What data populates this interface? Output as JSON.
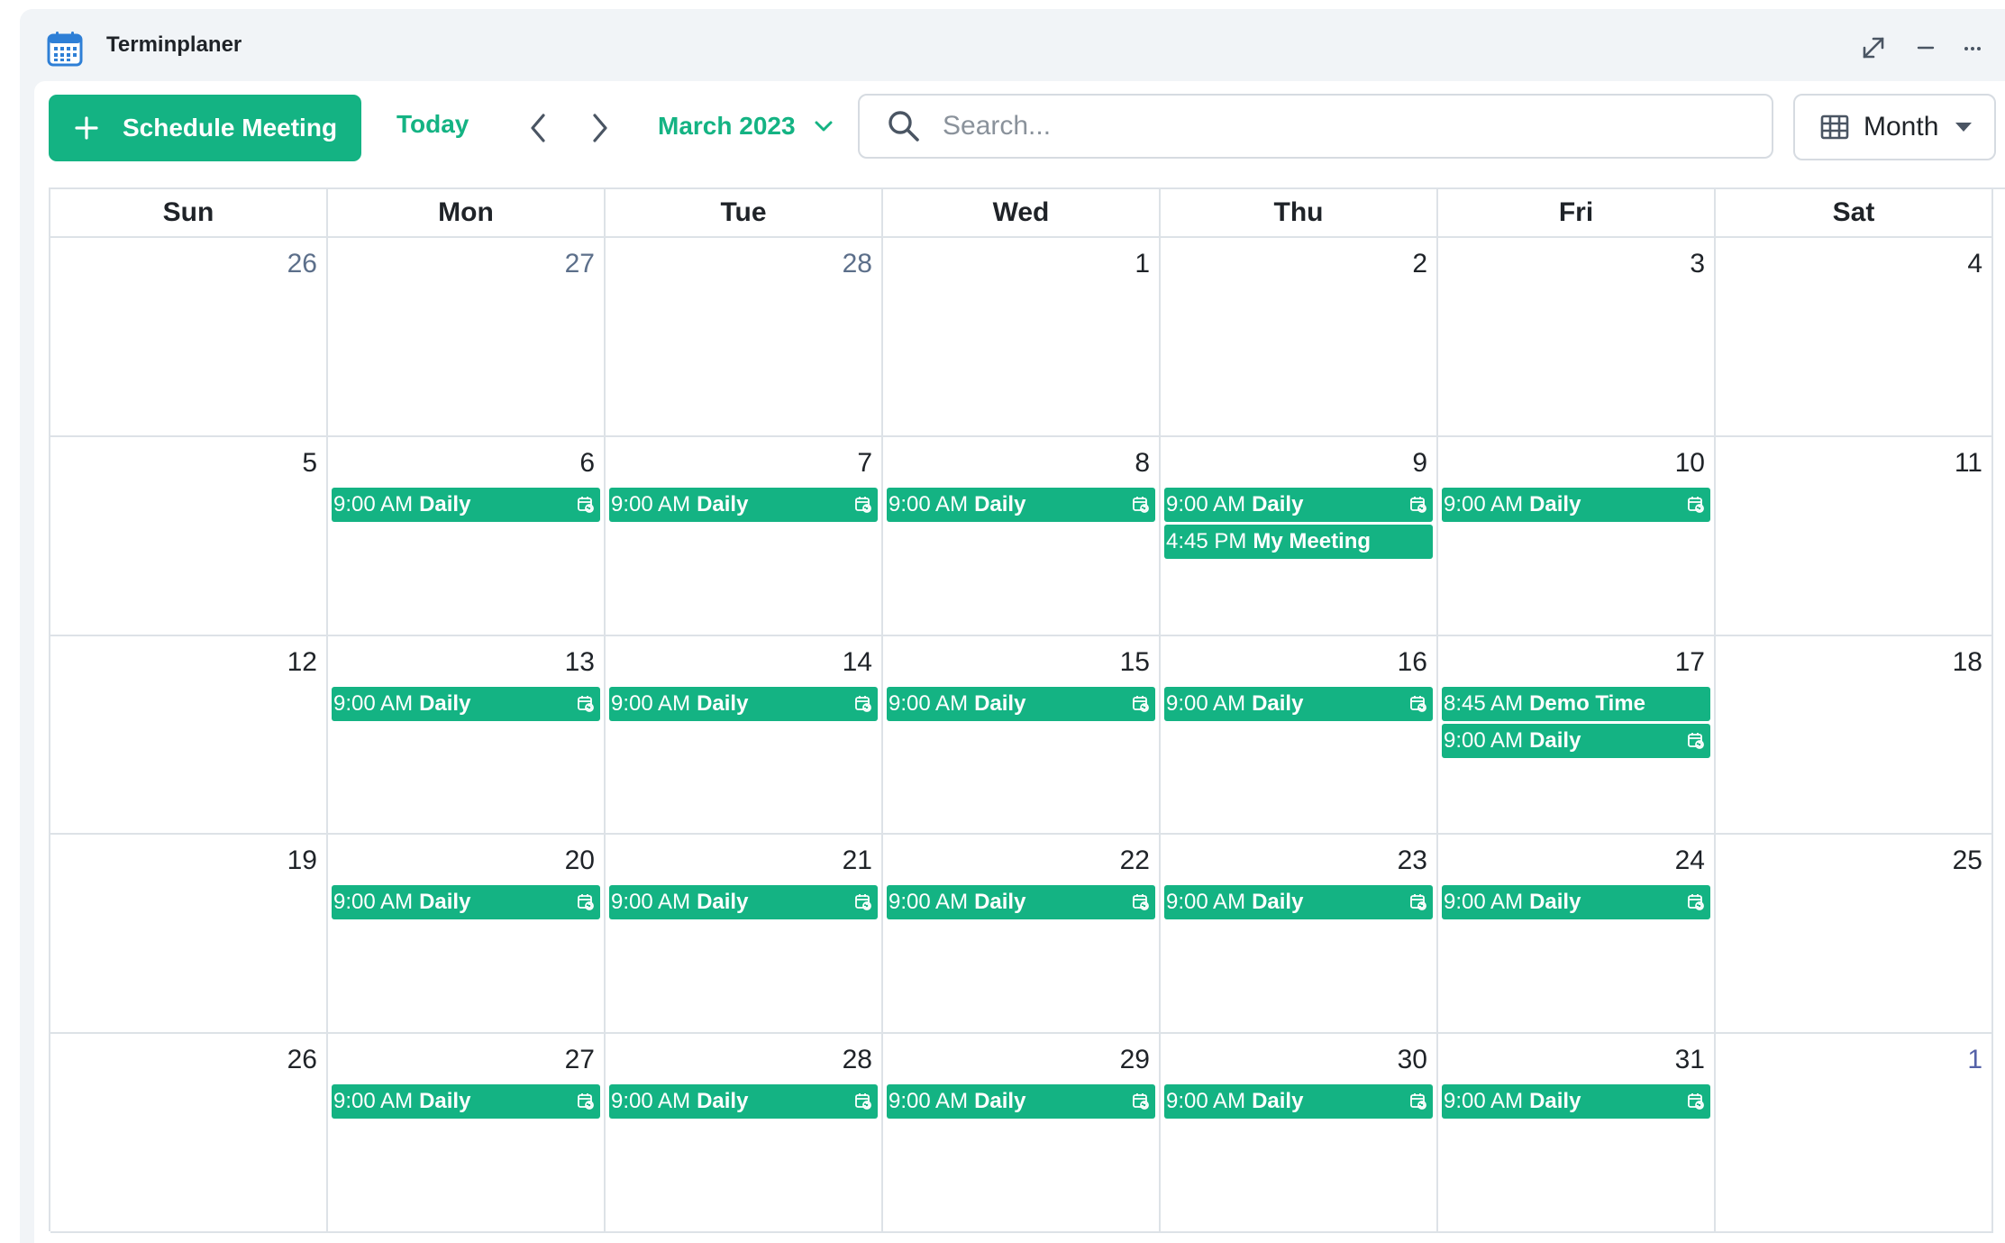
{
  "app": {
    "title": "Terminplaner"
  },
  "toolbar": {
    "schedule_label": "Schedule Meeting",
    "today_label": "Today",
    "month_label": "March 2023",
    "search_placeholder": "Search...",
    "view_label": "Month"
  },
  "colors": {
    "accent": "#14b383",
    "border": "#dde2e7",
    "muted_date": "#5c6f8a"
  },
  "calendar": {
    "weekdays": [
      "Sun",
      "Mon",
      "Tue",
      "Wed",
      "Thu",
      "Fri",
      "Sat"
    ],
    "weeks": [
      [
        {
          "date": "26",
          "month": "prev",
          "events": []
        },
        {
          "date": "27",
          "month": "prev",
          "events": []
        },
        {
          "date": "28",
          "month": "prev",
          "events": []
        },
        {
          "date": "1",
          "month": "current",
          "events": []
        },
        {
          "date": "2",
          "month": "current",
          "events": []
        },
        {
          "date": "3",
          "month": "current",
          "events": []
        },
        {
          "date": "4",
          "month": "current",
          "events": []
        }
      ],
      [
        {
          "date": "5",
          "month": "current",
          "events": []
        },
        {
          "date": "6",
          "month": "current",
          "events": [
            {
              "time": "9:00 AM",
              "title": "Daily",
              "recurring": true
            }
          ]
        },
        {
          "date": "7",
          "month": "current",
          "events": [
            {
              "time": "9:00 AM",
              "title": "Daily",
              "recurring": true
            }
          ]
        },
        {
          "date": "8",
          "month": "current",
          "events": [
            {
              "time": "9:00 AM",
              "title": "Daily",
              "recurring": true
            }
          ]
        },
        {
          "date": "9",
          "month": "current",
          "events": [
            {
              "time": "9:00 AM",
              "title": "Daily",
              "recurring": true
            },
            {
              "time": "4:45 PM",
              "title": "My Meeting",
              "recurring": false
            }
          ]
        },
        {
          "date": "10",
          "month": "current",
          "events": [
            {
              "time": "9:00 AM",
              "title": "Daily",
              "recurring": true
            }
          ]
        },
        {
          "date": "11",
          "month": "current",
          "events": []
        }
      ],
      [
        {
          "date": "12",
          "month": "current",
          "events": []
        },
        {
          "date": "13",
          "month": "current",
          "events": [
            {
              "time": "9:00 AM",
              "title": "Daily",
              "recurring": true
            }
          ]
        },
        {
          "date": "14",
          "month": "current",
          "events": [
            {
              "time": "9:00 AM",
              "title": "Daily",
              "recurring": true
            }
          ]
        },
        {
          "date": "15",
          "month": "current",
          "events": [
            {
              "time": "9:00 AM",
              "title": "Daily",
              "recurring": true
            }
          ]
        },
        {
          "date": "16",
          "month": "current",
          "events": [
            {
              "time": "9:00 AM",
              "title": "Daily",
              "recurring": true
            }
          ]
        },
        {
          "date": "17",
          "month": "current",
          "events": [
            {
              "time": "8:45 AM",
              "title": "Demo Time",
              "recurring": false
            },
            {
              "time": "9:00 AM",
              "title": "Daily",
              "recurring": true
            }
          ]
        },
        {
          "date": "18",
          "month": "current",
          "events": []
        }
      ],
      [
        {
          "date": "19",
          "month": "current",
          "events": []
        },
        {
          "date": "20",
          "month": "current",
          "events": [
            {
              "time": "9:00 AM",
              "title": "Daily",
              "recurring": true
            }
          ]
        },
        {
          "date": "21",
          "month": "current",
          "events": [
            {
              "time": "9:00 AM",
              "title": "Daily",
              "recurring": true
            }
          ]
        },
        {
          "date": "22",
          "month": "current",
          "events": [
            {
              "time": "9:00 AM",
              "title": "Daily",
              "recurring": true
            }
          ]
        },
        {
          "date": "23",
          "month": "current",
          "events": [
            {
              "time": "9:00 AM",
              "title": "Daily",
              "recurring": true
            }
          ]
        },
        {
          "date": "24",
          "month": "current",
          "events": [
            {
              "time": "9:00 AM",
              "title": "Daily",
              "recurring": true
            }
          ]
        },
        {
          "date": "25",
          "month": "current",
          "events": []
        }
      ],
      [
        {
          "date": "26",
          "month": "current",
          "events": []
        },
        {
          "date": "27",
          "month": "current",
          "events": [
            {
              "time": "9:00 AM",
              "title": "Daily",
              "recurring": true
            }
          ]
        },
        {
          "date": "28",
          "month": "current",
          "events": [
            {
              "time": "9:00 AM",
              "title": "Daily",
              "recurring": true
            }
          ]
        },
        {
          "date": "29",
          "month": "current",
          "events": [
            {
              "time": "9:00 AM",
              "title": "Daily",
              "recurring": true
            }
          ]
        },
        {
          "date": "30",
          "month": "current",
          "events": [
            {
              "time": "9:00 AM",
              "title": "Daily",
              "recurring": true
            }
          ]
        },
        {
          "date": "31",
          "month": "current",
          "events": [
            {
              "time": "9:00 AM",
              "title": "Daily",
              "recurring": true
            }
          ]
        },
        {
          "date": "1",
          "month": "next",
          "events": []
        }
      ]
    ]
  }
}
